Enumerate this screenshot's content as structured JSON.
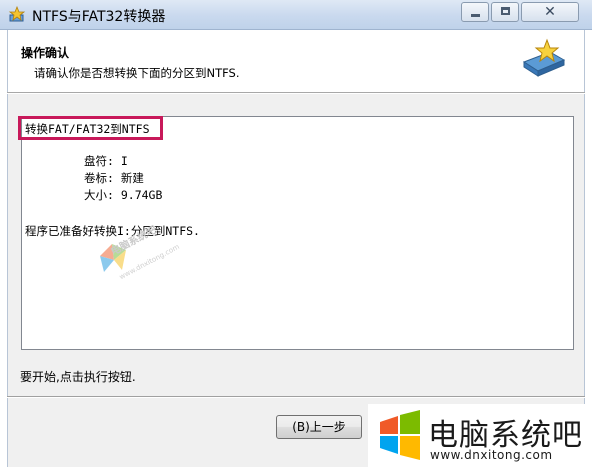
{
  "window": {
    "title": "NTFS与FAT32转换器"
  },
  "header": {
    "title": "操作确认",
    "subtitle": "请确认你是否想转换下面的分区到NTFS."
  },
  "info": {
    "operation": "转换FAT/FAT32到NTFS",
    "drive_letter": "盘符: I",
    "volume_label": "卷标: 新建",
    "size": "大小: 9.74GB",
    "ready_message": "程序已准备好转换I:分区到NTFS."
  },
  "instruction": "要开始,点击执行按钮.",
  "buttons": {
    "back": "(B)上一步"
  },
  "watermark": {
    "name": "电脑系统吧",
    "url": "www.dnxitong.com",
    "small_name": "电脑系统吧",
    "small_url": "www.dnxitong.com"
  },
  "colors": {
    "highlight": "#c8195a",
    "titlebar": "#c9d9ee"
  }
}
